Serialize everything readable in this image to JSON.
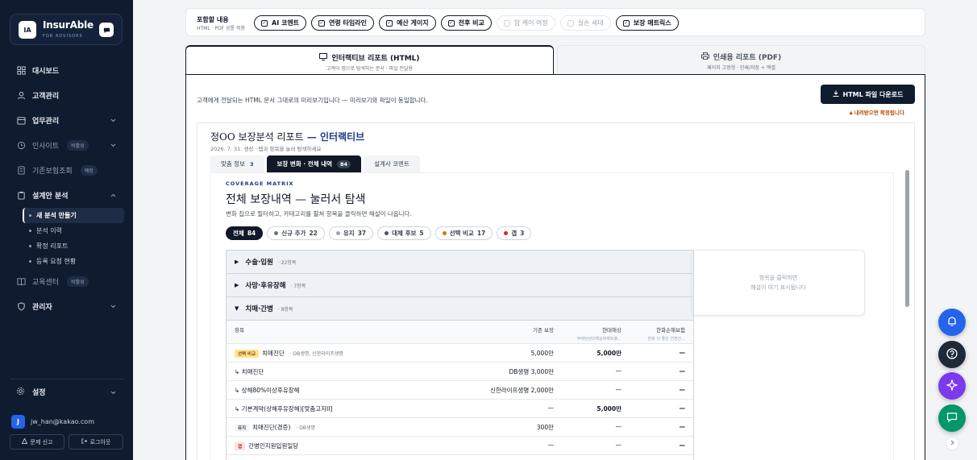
{
  "brand": {
    "badge": "IA",
    "name": "InsurAble",
    "sub": "FOR ADVISORS"
  },
  "nav": {
    "dashboard": "대시보드",
    "customers": "고객관리",
    "work": "업무관리",
    "insight": "인사이트",
    "insight_tag": "비활성",
    "legacy": "기존보험조회",
    "legacy_tag": "예정",
    "design": "설계안 분석",
    "design_sub": [
      "새 분석 만들기",
      "분석 이력",
      "확정 리포트",
      "등록 요청 현황"
    ],
    "edu": "교육센터",
    "edu_tag": "비활성",
    "admin": "관리자",
    "settings": "설정"
  },
  "user": {
    "initial": "J",
    "email": "jw_han@kakao.com",
    "report_btn": "문제 신고",
    "logout_btn": "로그아웃"
  },
  "filter": {
    "title": "포함할 내용",
    "sub": "HTML · PDF 공통 적용",
    "chips": [
      {
        "label": "AI 코멘트",
        "on": true
      },
      {
        "label": "연령 타임라인",
        "on": true
      },
      {
        "label": "예산 게이지",
        "on": true
      },
      {
        "label": "전후 비교",
        "on": true
      },
      {
        "label": "암 케어 여정",
        "on": false
      },
      {
        "label": "실손 세대",
        "on": false
      },
      {
        "label": "보장 매트릭스",
        "on": true
      }
    ]
  },
  "tabs": {
    "html_title": "인터랙티브 리포트 (HTML)",
    "html_sub": "고객이 앱으로 탐색하는 문서 · 파일 전달용",
    "pdf_title": "인쇄용 리포트 (PDF)",
    "pdf_sub": "페이지 고정형 · 인쇄/저장 + 엑셀"
  },
  "panel": {
    "desc": "고객에게 전달되는 HTML 문서 그대로의 미리보기입니다 — 미리보기와 파일이 동일합니다.",
    "download": "HTML 파일 다운로드",
    "note": "내려받으면 확정됩니다"
  },
  "report": {
    "title_a": "정OO 보장분석 리포트",
    "title_sep": " — ",
    "title_b": "인터랙티브",
    "sub": "2026. 7. 31. 생성 · 탭과 항목을 눌러 탐색하세요",
    "tabs": [
      {
        "label": "맞춤 정보",
        "count": "3"
      },
      {
        "label": "보장 변화 · 전체 내역",
        "count": "84"
      },
      {
        "label": "설계사 코멘트",
        "count": ""
      }
    ]
  },
  "matrix": {
    "kicker": "COVERAGE MATRIX",
    "title": "전체 보장내역 — 눌러서 탐색",
    "desc": "변화 칩으로 필터하고, 카테고리를 펼쳐 항목을 클릭하면 해설이 나옵니다.",
    "pills": [
      {
        "label": "전체",
        "count": "84",
        "color": ""
      },
      {
        "label": "신규 추가",
        "count": "22",
        "color": "#6b7280"
      },
      {
        "label": "유지",
        "count": "37",
        "color": "#9ca3af"
      },
      {
        "label": "대체 후보",
        "count": "5",
        "color": "#4b5563"
      },
      {
        "label": "선택 비교",
        "count": "17",
        "color": "#d97706"
      },
      {
        "label": "갭",
        "count": "3",
        "color": "#dc2626"
      }
    ],
    "groups": [
      {
        "name": "수술·입원",
        "count": "· 22항목",
        "open": false
      },
      {
        "name": "사망·후유장해",
        "count": "· 7항목",
        "open": false
      },
      {
        "name": "치매·간병",
        "count": "· 8항목",
        "open": true
      }
    ],
    "headers": {
      "item": "항목",
      "base": "기존 보장",
      "plan1": "현대해상",
      "plan1_sub": "무배당현대해상퍼펙트플...",
      "plan2": "한화손해보험",
      "plan2_sub": "한화 더 좋은 간편건..."
    },
    "rows": [
      {
        "badge": "선택 비교",
        "badge_type": "compare",
        "name": "치매진단",
        "ins": "· DB생명, 신한라이프생명",
        "base": "5,000만",
        "p1": "5,000만",
        "p2": "—",
        "p1_bold": true
      },
      {
        "badge": "",
        "badge_type": "",
        "name": "↳ 치매진단",
        "ins": "",
        "base": "DB생명 3,000만",
        "p1": "—",
        "p2": "—",
        "p1_bold": false
      },
      {
        "badge": "",
        "badge_type": "",
        "name": "↳ 상해80%이상후유장해",
        "ins": "",
        "base": "신한라이프생명 2,000만",
        "p1": "—",
        "p2": "—",
        "p1_bold": false
      },
      {
        "badge": "",
        "badge_type": "",
        "name": "↳ 기본계약(상해후유장해)[맞춤고지II]",
        "ins": "",
        "base": "—",
        "p1": "5,000만",
        "p2": "—",
        "p1_bold": true
      },
      {
        "badge": "유지",
        "badge_type": "keep",
        "name": "치매진단(경증)",
        "ins": "· DB생명",
        "base": "300만",
        "p1": "—",
        "p2": "—",
        "p1_bold": false
      },
      {
        "badge": "갭",
        "badge_type": "gap",
        "name": "간병인지원입원일당",
        "ins": "",
        "base": "—",
        "p1": "—",
        "p2": "—",
        "p1_bold": false
      }
    ],
    "explain_1": "항목을 클릭하면",
    "explain_2": "해설이 여기 표시됩니다"
  }
}
